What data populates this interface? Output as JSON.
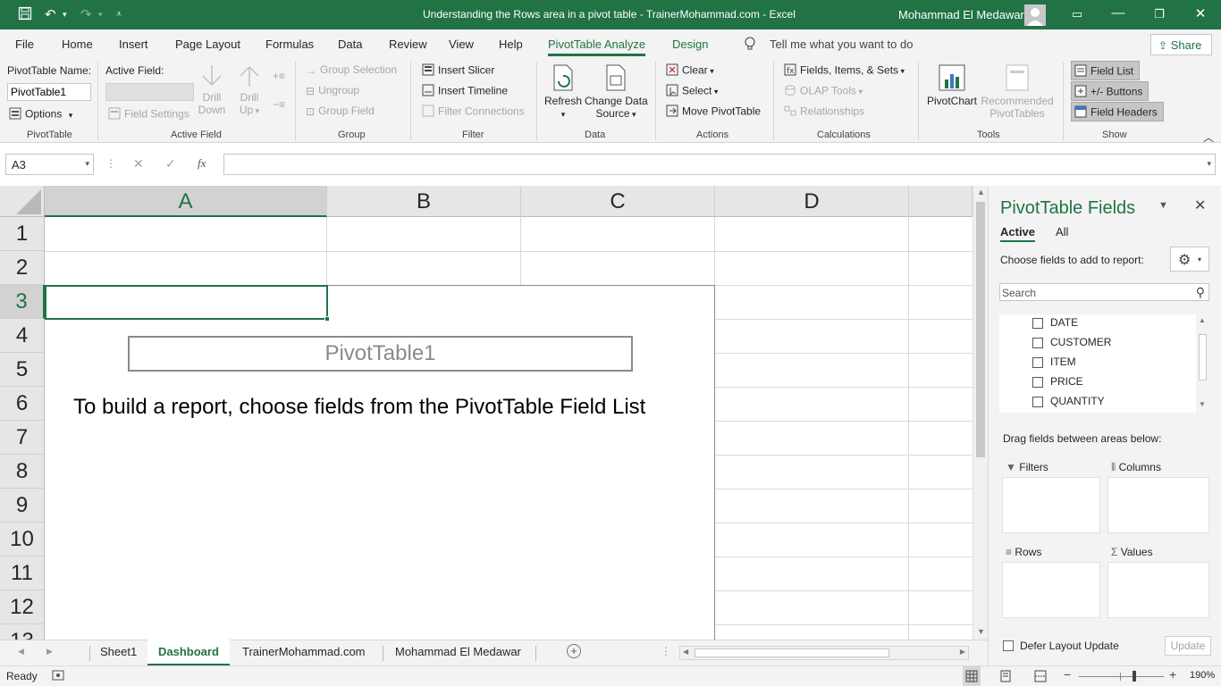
{
  "window": {
    "title": "Understanding the Rows area in a pivot table - TrainerMohammad.com  -  Excel",
    "user": "Mohammad El Medawar"
  },
  "tabs": [
    "File",
    "Home",
    "Insert",
    "Page Layout",
    "Formulas",
    "Data",
    "Review",
    "View",
    "Help",
    "PivotTable Analyze",
    "Design"
  ],
  "tell_me": "Tell me what you want to do",
  "share": "Share",
  "ribbon": {
    "pivottable": {
      "name_label": "PivotTable Name:",
      "name_value": "PivotTable1",
      "options": "Options",
      "group": "PivotTable"
    },
    "active_field": {
      "label": "Active Field:",
      "field_settings": "Field Settings",
      "drill_down_1": "Drill",
      "drill_down_2": "Down",
      "drill_up_1": "Drill",
      "drill_up_2": "Up",
      "group": "Active Field"
    },
    "group": {
      "group_selection": "Group Selection",
      "ungroup": "Ungroup",
      "group_field": "Group Field",
      "group": "Group"
    },
    "filter": {
      "insert_slicer": "Insert Slicer",
      "insert_timeline": "Insert Timeline",
      "filter_connections": "Filter Connections",
      "group": "Filter"
    },
    "data": {
      "refresh": "Refresh",
      "change_data_1": "Change Data",
      "change_data_2": "Source",
      "group": "Data"
    },
    "actions": {
      "clear": "Clear",
      "select": "Select",
      "move": "Move PivotTable",
      "group": "Actions"
    },
    "calculations": {
      "fields": "Fields, Items, & Sets",
      "olap": "OLAP Tools",
      "relationships": "Relationships",
      "group": "Calculations"
    },
    "tools": {
      "pivotchart": "PivotChart",
      "recommended_1": "Recommended",
      "recommended_2": "PivotTables",
      "group": "Tools"
    },
    "show": {
      "field_list": "Field List",
      "buttons": "+/- Buttons",
      "field_headers": "Field Headers",
      "group": "Show"
    }
  },
  "formula_bar": {
    "name_box": "A3",
    "fx": "fx",
    "formula": ""
  },
  "grid": {
    "columns": [
      "A",
      "B",
      "C",
      "D"
    ],
    "rows": [
      "1",
      "2",
      "3",
      "4",
      "5",
      "6",
      "7",
      "8",
      "9",
      "10",
      "11",
      "12",
      "13"
    ],
    "pivot_name": "PivotTable1",
    "pivot_instruction": "To build a report, choose fields from the PivotTable Field List"
  },
  "pane": {
    "title": "PivotTable Fields",
    "tab_active": "Active",
    "tab_all": "All",
    "choose_label": "Choose fields to add to report:",
    "search_placeholder": "Search",
    "fields": [
      "DATE",
      "CUSTOMER",
      "ITEM",
      "PRICE",
      "QUANTITY"
    ],
    "drag_label": "Drag fields between areas below:",
    "areas": {
      "filters": "Filters",
      "columns": "Columns",
      "rows": "Rows",
      "values": "Values"
    },
    "defer": "Defer Layout Update",
    "update": "Update"
  },
  "sheet_tabs": [
    "Sheet1",
    "Dashboard",
    "TrainerMohammad.com",
    "Mohammad El Medawar"
  ],
  "status": {
    "ready": "Ready",
    "zoom": "190%"
  },
  "colors": {
    "accent": "#217346",
    "selected_header": "#d2d2d2"
  }
}
